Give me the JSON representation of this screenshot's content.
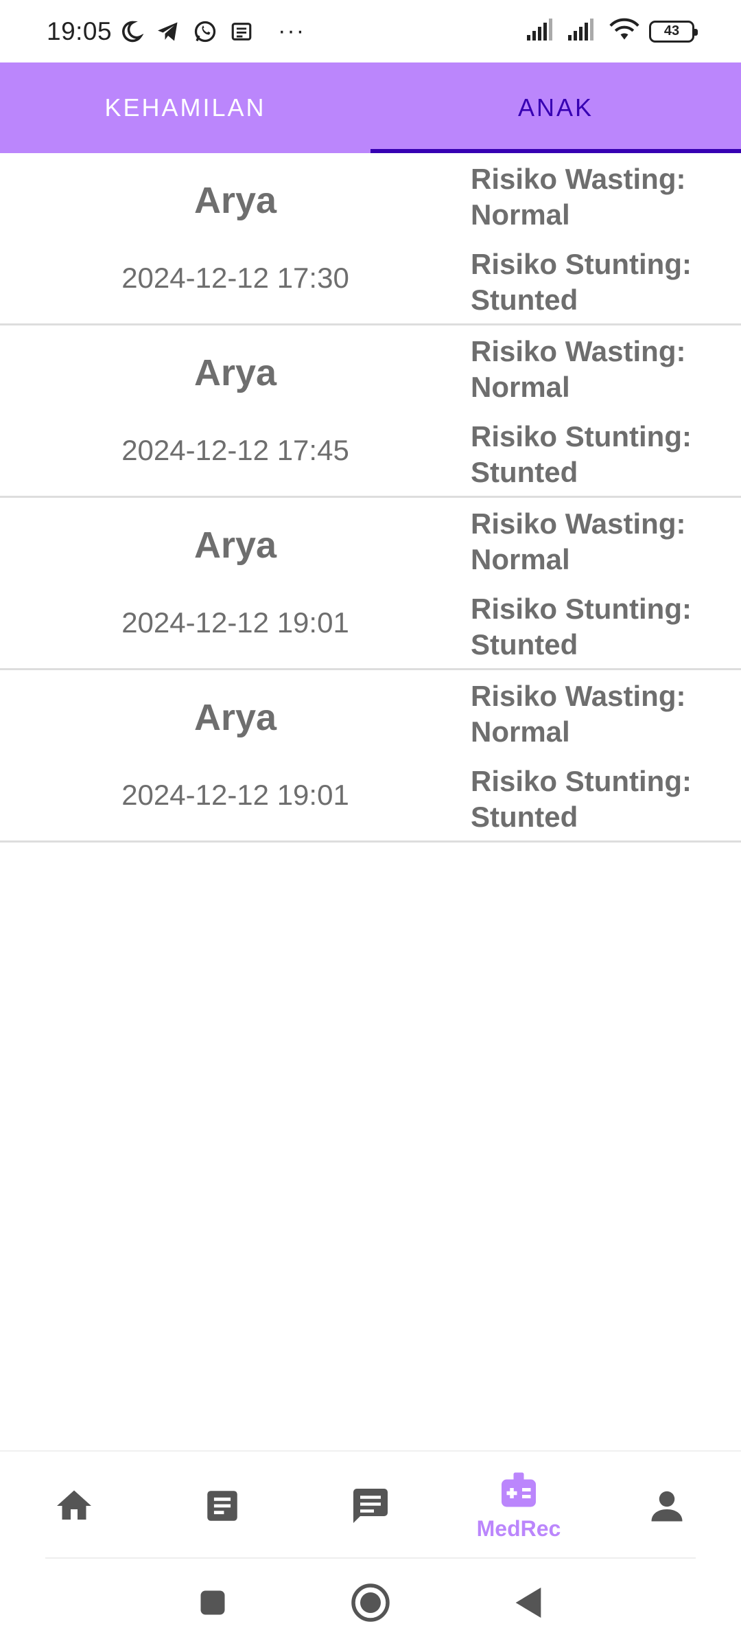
{
  "status_bar": {
    "time": "19:05",
    "overflow": "···",
    "battery": "43",
    "left_icons": [
      "moon-icon",
      "telegram-icon",
      "whatsapp-icon",
      "notes-icon"
    ],
    "right_icons": [
      "signal-icon",
      "signal-icon",
      "wifi-icon",
      "battery-icon"
    ]
  },
  "tabs": [
    {
      "label": "KEHAMILAN",
      "active": false
    },
    {
      "label": "ANAK",
      "active": true
    }
  ],
  "records": [
    {
      "name": "Arya",
      "datetime": "2024-12-12 17:30",
      "wasting": "Risiko Wasting: Normal",
      "stunting": "Risiko Stunting: Stunted"
    },
    {
      "name": "Arya",
      "datetime": "2024-12-12 17:45",
      "wasting": "Risiko Wasting: Normal",
      "stunting": "Risiko Stunting: Stunted"
    },
    {
      "name": "Arya",
      "datetime": "2024-12-12 19:01",
      "wasting": "Risiko Wasting: Normal",
      "stunting": "Risiko Stunting: Stunted"
    },
    {
      "name": "Arya",
      "datetime": "2024-12-12 19:01",
      "wasting": "Risiko Wasting: Normal",
      "stunting": "Risiko Stunting: Stunted"
    }
  ],
  "bottom_nav": [
    {
      "icon": "home-icon",
      "label": "",
      "active": false
    },
    {
      "icon": "article-icon",
      "label": "",
      "active": false
    },
    {
      "icon": "chat-icon",
      "label": "",
      "active": false
    },
    {
      "icon": "medrec-icon",
      "label": "MedRec",
      "active": true
    },
    {
      "icon": "person-icon",
      "label": "",
      "active": false
    }
  ],
  "colors": {
    "accent": "#bb86fc",
    "tab_active": "#3700b3",
    "text_gray": "#6e6e6e",
    "nav_icon": "#555555"
  }
}
